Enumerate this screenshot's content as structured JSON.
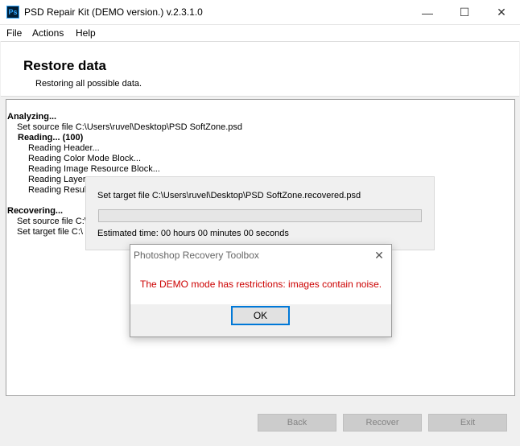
{
  "window": {
    "title": "PSD Repair Kit (DEMO version.) v.2.3.1.0",
    "icon_text": "Ps",
    "minimize_icon": "—",
    "maximize_icon": "☐",
    "close_icon": "✕"
  },
  "menu": {
    "items": [
      "File",
      "Actions",
      "Help"
    ]
  },
  "header": {
    "title": "Restore data",
    "subtitle": "Restoring all possible data."
  },
  "log": {
    "lines": [
      "Analyzing...",
      "Set source file C:\\Users\\ruvel\\Desktop\\PSD SoftZone.psd",
      "Reading... (100)",
      "Reading Header...",
      "Reading Color Mode Block...",
      "Reading Image Resource Block...",
      "Reading Layer",
      "Reading Result",
      "Recovering...",
      "Set source file C:\\",
      "Set target file C:\\"
    ]
  },
  "progress": {
    "target_text": "Set target file C:\\Users\\ruvel\\Desktop\\PSD SoftZone.recovered.psd",
    "fraction": 0,
    "estimated_time": "Estimated time: 00 hours 00 minutes 00 seconds"
  },
  "dialog": {
    "title": "Photoshop Recovery Toolbox",
    "close_icon": "✕",
    "message": "The DEMO mode has restrictions: images contain noise.",
    "ok_label": "OK"
  },
  "buttons": {
    "back": "Back",
    "recover": "Recover",
    "exit": "Exit"
  },
  "colors": {
    "message_red": "#cc0000",
    "focus_blue": "#0078d7"
  }
}
